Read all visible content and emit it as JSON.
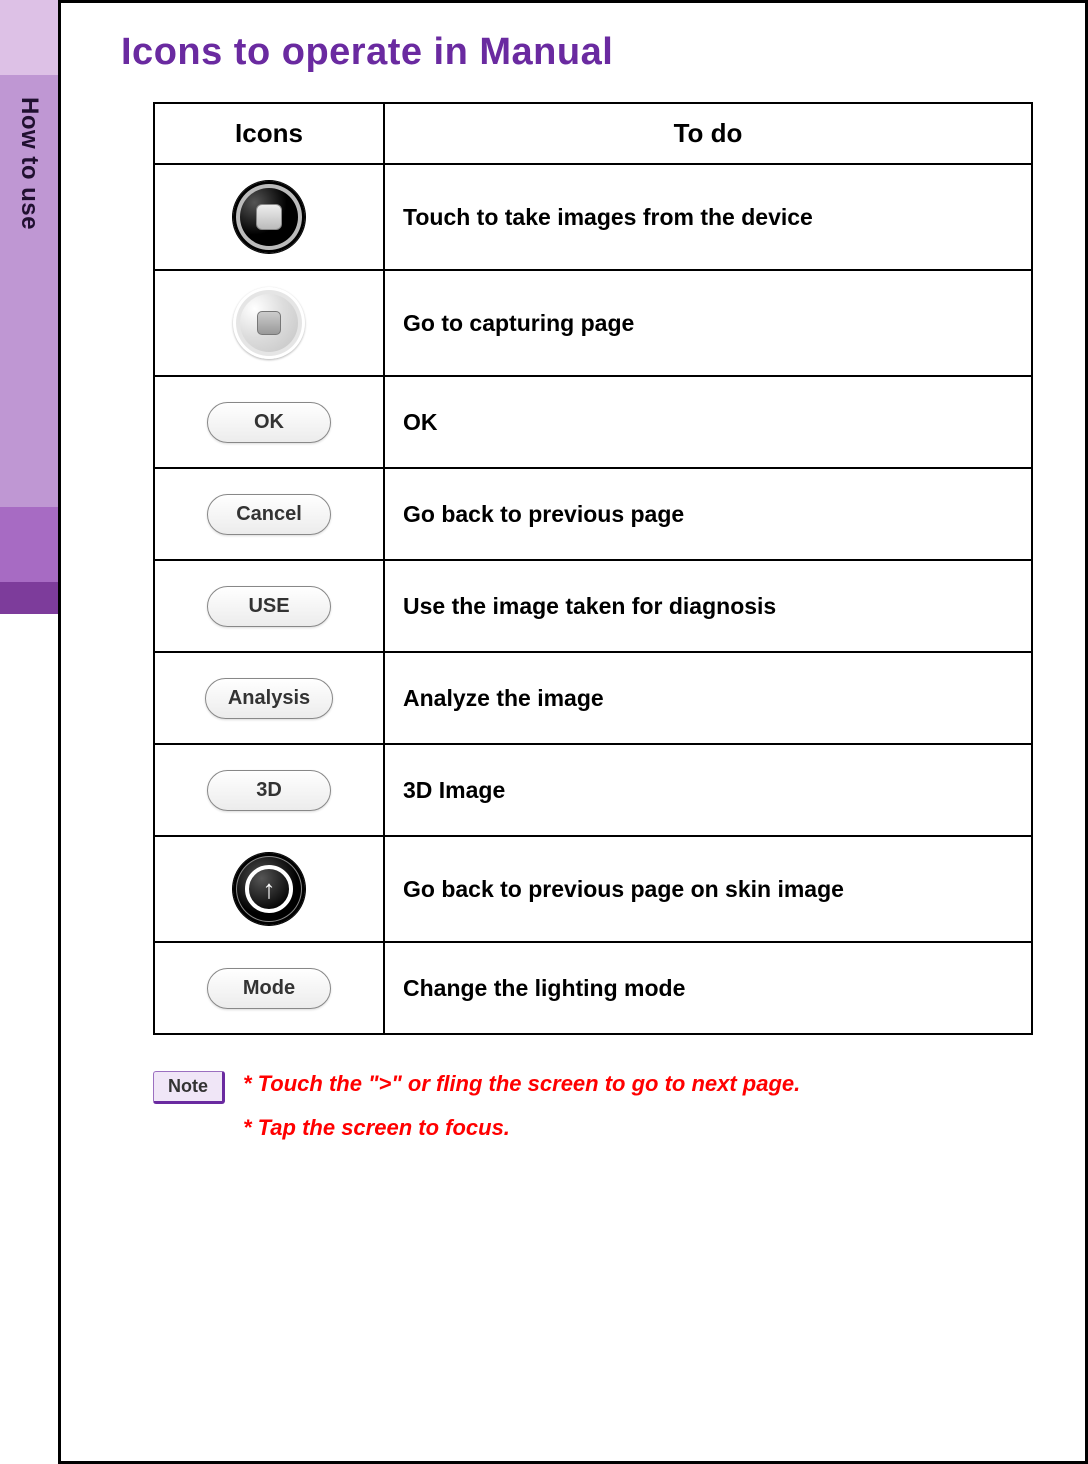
{
  "sidebar": {
    "section_label": "How to use"
  },
  "page": {
    "title": "Icons to operate in Manual"
  },
  "table": {
    "header_icons": "Icons",
    "header_todo": "To do",
    "rows": [
      {
        "icon_type": "capture-dark",
        "label": "",
        "desc": "Touch to take images from the device"
      },
      {
        "icon_type": "capture-light",
        "label": "",
        "desc": "Go to capturing page"
      },
      {
        "icon_type": "pill",
        "label": "OK",
        "desc": "OK"
      },
      {
        "icon_type": "pill",
        "label": "Cancel",
        "desc": "Go back to previous page"
      },
      {
        "icon_type": "pill",
        "label": "USE",
        "desc": "Use the image taken for diagnosis"
      },
      {
        "icon_type": "pill",
        "label": "Analysis",
        "desc": "Analyze the image"
      },
      {
        "icon_type": "pill",
        "label": "3D",
        "desc": "3D Image"
      },
      {
        "icon_type": "arrow-up",
        "label": "",
        "desc": "Go back to previous page on skin image"
      },
      {
        "icon_type": "pill",
        "label": "Mode",
        "desc": "Change the lighting mode"
      }
    ]
  },
  "note": {
    "badge": "Note",
    "line1": "* Touch the \">\" or fling the screen to go to next page.",
    "line2": "* Tap the screen to focus."
  }
}
